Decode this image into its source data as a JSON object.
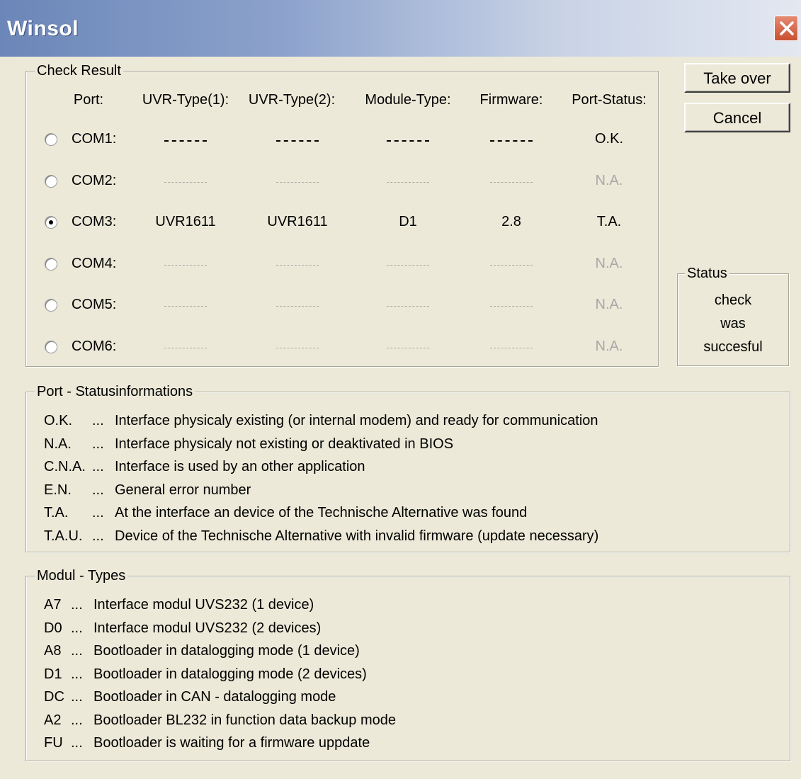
{
  "window": {
    "title": "Winsol"
  },
  "buttons": {
    "take_over": "Take over",
    "cancel": "Cancel"
  },
  "check_result": {
    "label": "Check Result",
    "headers": [
      "Port:",
      "UVR-Type(1):",
      "UVR-Type(2):",
      "Module-Type:",
      "Firmware:",
      "Port-Status:"
    ],
    "rows": [
      {
        "port": "COM1:",
        "selected": false,
        "uvr1": "",
        "uvr2": "",
        "module": "",
        "firmware": "",
        "status": "O.K.",
        "available": true
      },
      {
        "port": "COM2:",
        "selected": false,
        "uvr1": "",
        "uvr2": "",
        "module": "",
        "firmware": "",
        "status": "N.A.",
        "available": false
      },
      {
        "port": "COM3:",
        "selected": true,
        "uvr1": "UVR1611",
        "uvr2": "UVR1611",
        "module": "D1",
        "firmware": "2.8",
        "status": "T.A.",
        "available": true
      },
      {
        "port": "COM4:",
        "selected": false,
        "uvr1": "",
        "uvr2": "",
        "module": "",
        "firmware": "",
        "status": "N.A.",
        "available": false
      },
      {
        "port": "COM5:",
        "selected": false,
        "uvr1": "",
        "uvr2": "",
        "module": "",
        "firmware": "",
        "status": "N.A.",
        "available": false
      },
      {
        "port": "COM6:",
        "selected": false,
        "uvr1": "",
        "uvr2": "",
        "module": "",
        "firmware": "",
        "status": "N.A.",
        "available": false
      }
    ]
  },
  "status_box": {
    "label": "Status",
    "lines": [
      "check",
      "was",
      "succesful"
    ]
  },
  "port_status_info": {
    "label": "Port - Statusinformations",
    "items": [
      {
        "code": "O.K.",
        "sep": "...",
        "text": "Interface physicaly existing (or internal modem) and ready for communication"
      },
      {
        "code": "N.A.",
        "sep": "...",
        "text": "Interface physicaly not existing or deaktivated in BIOS"
      },
      {
        "code": "C.N.A.",
        "sep": "...",
        "text": "Interface is used by an other application"
      },
      {
        "code": "E.N.",
        "sep": "...",
        "text": "General error number"
      },
      {
        "code": "T.A.",
        "sep": "...",
        "text": "At the interface an device of the Technische Alternative was found"
      },
      {
        "code": "T.A.U.",
        "sep": "...",
        "text": "Device of the Technische Alternative with invalid firmware (update necessary)"
      }
    ]
  },
  "module_types": {
    "label": "Modul - Types",
    "items": [
      {
        "code": "A7",
        "sep": "...",
        "text": "Interface modul UVS232 (1 device)"
      },
      {
        "code": "D0",
        "sep": "...",
        "text": "Interface modul UVS232 (2 devices)"
      },
      {
        "code": "A8",
        "sep": "...",
        "text": "Bootloader in datalogging mode (1 device)"
      },
      {
        "code": "D1",
        "sep": "...",
        "text": "Bootloader in datalogging mode (2 devices)"
      },
      {
        "code": "DC",
        "sep": "...",
        "text": "Bootloader in CAN - datalogging mode"
      },
      {
        "code": "A2",
        "sep": "...",
        "text": "Bootloader BL232 in function data backup mode"
      },
      {
        "code": "FU",
        "sep": "...",
        "text": "Bootloader is waiting for a firmware uppdate"
      }
    ]
  },
  "colors": {
    "dialog_bg": "#ece9d8",
    "title_start": "#6b86b8",
    "close_red": "#c8502f",
    "disabled_text": "#a8a8a8"
  },
  "icons": {
    "close": "close-x-icon",
    "radio": "radio-button-icon"
  }
}
